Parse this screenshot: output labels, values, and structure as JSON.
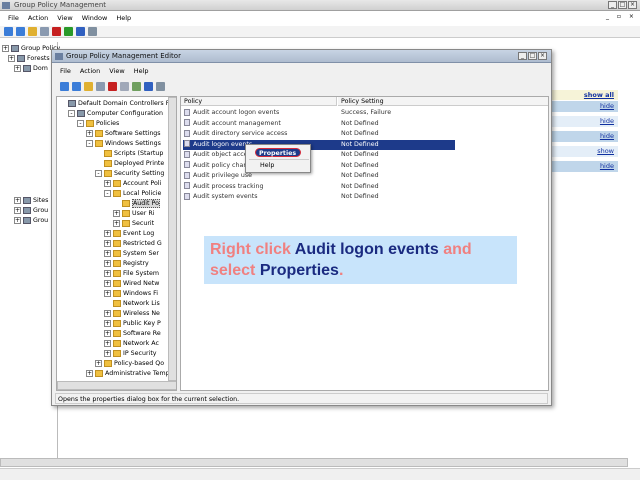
{
  "outer": {
    "title": "Group Policy Management",
    "menu": [
      "File",
      "Action",
      "View",
      "Window",
      "Help"
    ],
    "tree": [
      "Group Policy",
      "Forests",
      "Dom",
      "",
      "",
      "",
      "",
      "",
      "",
      "",
      "",
      "",
      "",
      "Sites",
      "Grou",
      "Grou"
    ],
    "links": [
      "show all",
      "hide",
      "hide",
      "hide",
      "show",
      "hide"
    ]
  },
  "inner": {
    "title": "Group Policy Management Editor",
    "menu": [
      "File",
      "Action",
      "View",
      "Help"
    ],
    "tree": [
      {
        "label": "Default Domain Controllers Policy",
        "lvl": 0,
        "exp": "",
        "ico": "g"
      },
      {
        "label": "Computer Configuration",
        "lvl": 1,
        "exp": "-",
        "ico": "g"
      },
      {
        "label": "Policies",
        "lvl": 2,
        "exp": "-",
        "ico": "f"
      },
      {
        "label": "Software Settings",
        "lvl": 3,
        "exp": "+",
        "ico": "f"
      },
      {
        "label": "Windows Settings",
        "lvl": 3,
        "exp": "-",
        "ico": "f"
      },
      {
        "label": "Scripts (Startup",
        "lvl": 4,
        "exp": "",
        "ico": "f"
      },
      {
        "label": "Deployed Printe",
        "lvl": 4,
        "exp": "",
        "ico": "f"
      },
      {
        "label": "Security Setting",
        "lvl": 4,
        "exp": "-",
        "ico": "f"
      },
      {
        "label": "Account Poli",
        "lvl": 5,
        "exp": "+",
        "ico": "f"
      },
      {
        "label": "Local Policie",
        "lvl": 5,
        "exp": "-",
        "ico": "f"
      },
      {
        "label": "Audit Po",
        "lvl": 6,
        "exp": "",
        "ico": "f",
        "sel": true
      },
      {
        "label": "User Ri",
        "lvl": 6,
        "exp": "+",
        "ico": "f"
      },
      {
        "label": "Securit",
        "lvl": 6,
        "exp": "+",
        "ico": "f"
      },
      {
        "label": "Event Log",
        "lvl": 5,
        "exp": "+",
        "ico": "f"
      },
      {
        "label": "Restricted G",
        "lvl": 5,
        "exp": "+",
        "ico": "f"
      },
      {
        "label": "System Ser",
        "lvl": 5,
        "exp": "+",
        "ico": "f"
      },
      {
        "label": "Registry",
        "lvl": 5,
        "exp": "+",
        "ico": "f"
      },
      {
        "label": "File System",
        "lvl": 5,
        "exp": "+",
        "ico": "f"
      },
      {
        "label": "Wired Netw",
        "lvl": 5,
        "exp": "+",
        "ico": "f"
      },
      {
        "label": "Windows Fi",
        "lvl": 5,
        "exp": "+",
        "ico": "f"
      },
      {
        "label": "Network Lis",
        "lvl": 5,
        "exp": "",
        "ico": "f"
      },
      {
        "label": "Wireless Ne",
        "lvl": 5,
        "exp": "+",
        "ico": "f"
      },
      {
        "label": "Public Key P",
        "lvl": 5,
        "exp": "+",
        "ico": "f"
      },
      {
        "label": "Software Re",
        "lvl": 5,
        "exp": "+",
        "ico": "f"
      },
      {
        "label": "Network Ac",
        "lvl": 5,
        "exp": "+",
        "ico": "f"
      },
      {
        "label": "IP Security",
        "lvl": 5,
        "exp": "+",
        "ico": "f"
      },
      {
        "label": "Policy-based Qo",
        "lvl": 4,
        "exp": "+",
        "ico": "f"
      },
      {
        "label": "Administrative Temp",
        "lvl": 3,
        "exp": "+",
        "ico": "f"
      }
    ],
    "col_policy": "Policy",
    "col_setting": "Policy Setting",
    "policies": [
      {
        "name": "Audit account logon events",
        "setting": "Success, Failure"
      },
      {
        "name": "Audit account management",
        "setting": "Not Defined"
      },
      {
        "name": "Audit directory service access",
        "setting": "Not Defined"
      },
      {
        "name": "Audit logon events",
        "setting": "Not Defined",
        "sel": true
      },
      {
        "name": "Audit object acce",
        "setting": "Not Defined"
      },
      {
        "name": "Audit policy chang",
        "setting": "Not Defined"
      },
      {
        "name": "Audit privilege use",
        "setting": "Not Defined"
      },
      {
        "name": "Audit process tracking",
        "setting": "Not Defined"
      },
      {
        "name": "Audit system events",
        "setting": "Not Defined"
      }
    ],
    "ctx": {
      "properties": "Properties",
      "help": "Help"
    },
    "status": "Opens the properties dialog box for the current selection."
  },
  "callout": {
    "p1": "Right click ",
    "p2": "Audit logon events",
    "p3": " and",
    "p4": "select ",
    "p5": "Properties",
    "p6": ".",
    "c_red": "#f08080",
    "c_blue": "#1a2a80",
    "bg": "#c8e4fb"
  }
}
